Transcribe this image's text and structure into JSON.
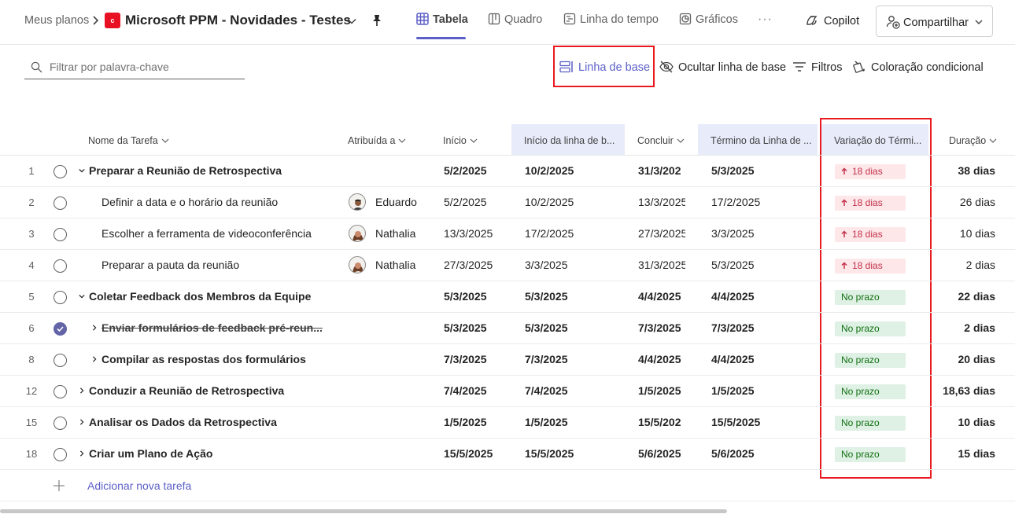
{
  "breadcrumb": {
    "root": "Meus planos"
  },
  "app_logo_letter": "c",
  "plan": {
    "title": "Microsoft PPM - Novidades - Testes"
  },
  "tabs": [
    {
      "label": "Tabela",
      "icon": "grid-icon",
      "active": true
    },
    {
      "label": "Quadro",
      "icon": "board-icon",
      "active": false
    },
    {
      "label": "Linha do tempo",
      "icon": "timeline-icon",
      "active": false
    },
    {
      "label": "Gráficos",
      "icon": "charts-icon",
      "active": false
    }
  ],
  "more_label": "···",
  "copilot_label": "Copilot",
  "share_label": "Compartilhar",
  "filter": {
    "placeholder": "Filtrar por palavra-chave"
  },
  "toolbar": {
    "baseline": "Linha de base",
    "hide_baseline": "Ocultar linha de base",
    "filters": "Filtros",
    "conditional": "Coloração condicional"
  },
  "columns": {
    "task": "Nome da Tarefa",
    "assigned": "Atribuída a",
    "start": "Início",
    "baseline_start": "Início da linha de b...",
    "finish": "Concluir",
    "baseline_finish": "Término da Linha de ...",
    "variance": "Variação do Térmi...",
    "duration": "Duração"
  },
  "rows": [
    {
      "id": "1",
      "level": 0,
      "parent": true,
      "expander": "down",
      "done": false,
      "task": "Preparar a Reunião de Retrospectiva",
      "assignee": "",
      "avatar": "",
      "start": "5/2/2025",
      "baseline_start": "10/2/2025",
      "finish": "31/3/202",
      "baseline_finish": "5/3/2025",
      "variance": "18 dias",
      "variance_type": "late",
      "duration": "38 dias"
    },
    {
      "id": "2",
      "level": 1,
      "parent": false,
      "expander": "",
      "done": false,
      "task": "Definir a data e o horário da reunião",
      "assignee": "Eduardo",
      "avatar": "male",
      "start": "5/2/2025",
      "baseline_start": "10/2/2025",
      "finish": "13/3/2025",
      "baseline_finish": "17/2/2025",
      "variance": "18 dias",
      "variance_type": "late",
      "duration": "26 dias"
    },
    {
      "id": "3",
      "level": 1,
      "parent": false,
      "expander": "",
      "done": false,
      "task": "Escolher a ferramenta de videoconferência",
      "assignee": "Nathalia",
      "avatar": "female",
      "start": "13/3/2025",
      "baseline_start": "17/2/2025",
      "finish": "27/3/2025",
      "baseline_finish": "3/3/2025",
      "variance": "18 dias",
      "variance_type": "late",
      "duration": "10 dias"
    },
    {
      "id": "4",
      "level": 1,
      "parent": false,
      "expander": "",
      "done": false,
      "task": "Preparar a pauta da reunião",
      "assignee": "Nathalia",
      "avatar": "female",
      "start": "27/3/2025",
      "baseline_start": "3/3/2025",
      "finish": "31/3/2025",
      "baseline_finish": "5/3/2025",
      "variance": "18 dias",
      "variance_type": "late",
      "duration": "2 dias"
    },
    {
      "id": "5",
      "level": 0,
      "parent": true,
      "expander": "down",
      "done": false,
      "task": "Coletar Feedback dos Membros da Equipe",
      "assignee": "",
      "avatar": "",
      "start": "5/3/2025",
      "baseline_start": "5/3/2025",
      "finish": "4/4/2025",
      "baseline_finish": "4/4/2025",
      "variance": "No prazo",
      "variance_type": "ok",
      "duration": "22 dias"
    },
    {
      "id": "6",
      "level": 1,
      "parent": true,
      "expander": "right",
      "done": true,
      "task": "Enviar formulários de feedback pré-reun...",
      "assignee": "",
      "avatar": "",
      "start": "5/3/2025",
      "baseline_start": "5/3/2025",
      "finish": "7/3/2025",
      "baseline_finish": "7/3/2025",
      "variance": "No prazo",
      "variance_type": "ok",
      "duration": "2 dias"
    },
    {
      "id": "8",
      "level": 1,
      "parent": true,
      "expander": "right",
      "done": false,
      "task": "Compilar as respostas dos formulários",
      "assignee": "",
      "avatar": "",
      "start": "7/3/2025",
      "baseline_start": "7/3/2025",
      "finish": "4/4/2025",
      "baseline_finish": "4/4/2025",
      "variance": "No prazo",
      "variance_type": "ok",
      "duration": "20 dias"
    },
    {
      "id": "12",
      "level": 0,
      "parent": true,
      "expander": "right",
      "done": false,
      "task": "Conduzir a Reunião de Retrospectiva",
      "assignee": "",
      "avatar": "",
      "start": "7/4/2025",
      "baseline_start": "7/4/2025",
      "finish": "1/5/2025",
      "baseline_finish": "1/5/2025",
      "variance": "No prazo",
      "variance_type": "ok",
      "duration": "18,63 dias"
    },
    {
      "id": "15",
      "level": 0,
      "parent": true,
      "expander": "right",
      "done": false,
      "task": "Analisar os Dados da Retrospectiva",
      "assignee": "",
      "avatar": "",
      "start": "1/5/2025",
      "baseline_start": "1/5/2025",
      "finish": "15/5/202",
      "baseline_finish": "15/5/2025",
      "variance": "No prazo",
      "variance_type": "ok",
      "duration": "10 dias"
    },
    {
      "id": "18",
      "level": 0,
      "parent": true,
      "expander": "right",
      "done": false,
      "task": "Criar um Plano de Ação",
      "assignee": "",
      "avatar": "",
      "start": "15/5/2025",
      "baseline_start": "15/5/2025",
      "finish": "5/6/2025",
      "baseline_finish": "5/6/2025",
      "variance": "No prazo",
      "variance_type": "ok",
      "duration": "15 dias"
    }
  ],
  "add_task_label": "Adicionar nova tarefa",
  "colors": {
    "accent": "#5b5fc7",
    "highlight_box": "#e8191f",
    "late_bg": "#fde7e9",
    "late_text": "#c4314b",
    "ok_bg": "#dff0e5",
    "ok_text": "#0e700e",
    "baseline_col_bg": "#e8ebfa"
  }
}
